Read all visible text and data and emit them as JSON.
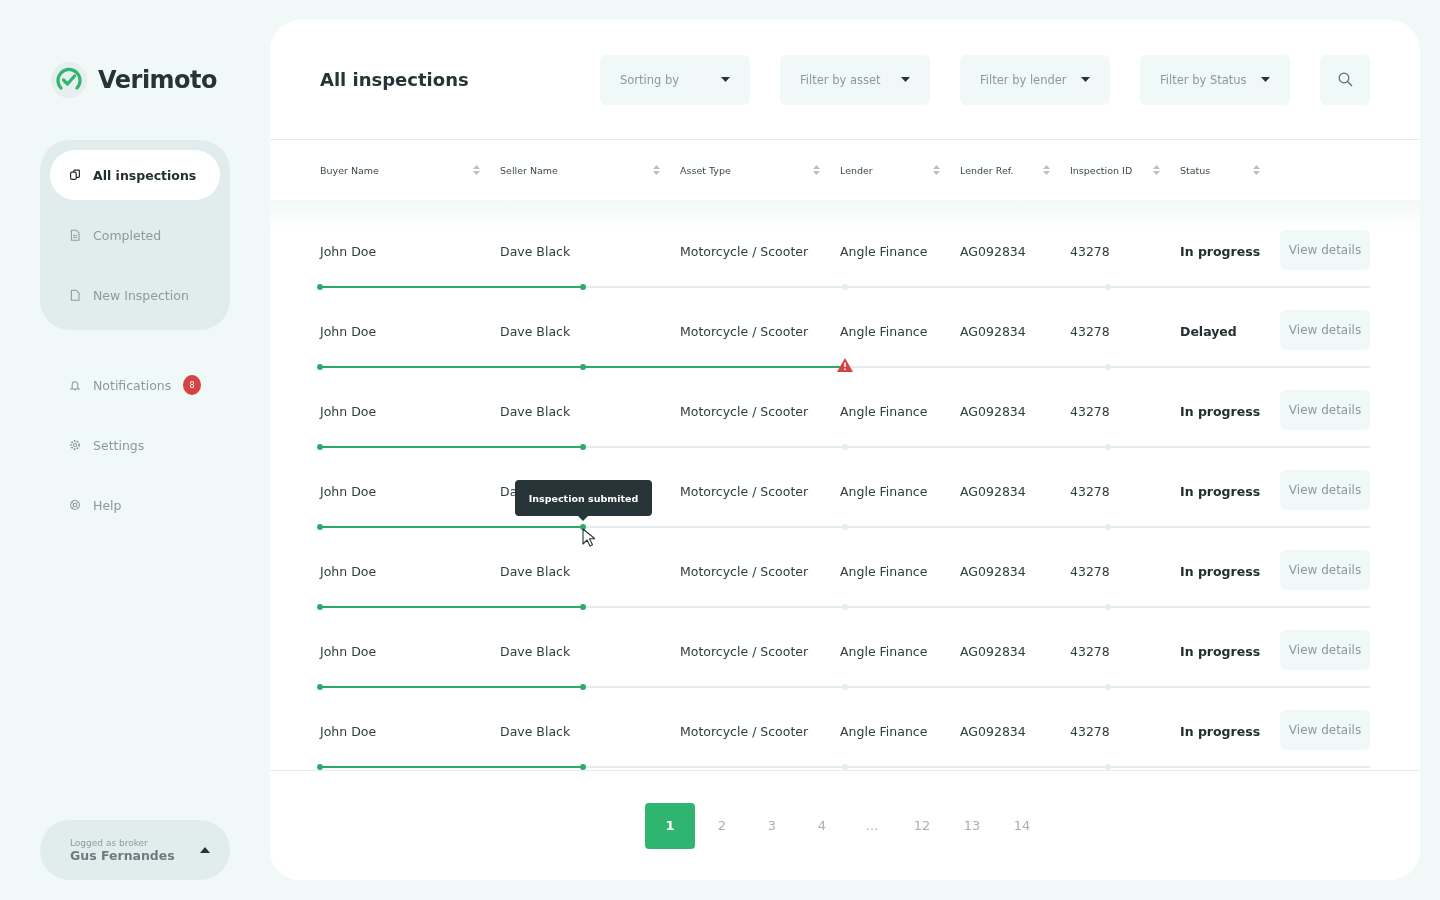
{
  "brand": {
    "name": "Verimoto"
  },
  "nav": [
    {
      "label": "All inspections",
      "selected": true
    },
    {
      "label": "Completed",
      "selected": false
    },
    {
      "label": "New Inspection",
      "selected": false
    }
  ],
  "nav_secondary": [
    {
      "label": "Notifications",
      "badge": "8"
    },
    {
      "label": "Settings"
    },
    {
      "label": "Help"
    }
  ],
  "user": {
    "caption": "Logged as broker",
    "name": "Gus Fernandes"
  },
  "page_title": "All inspections",
  "filters": [
    {
      "placeholder": "Sorting by"
    },
    {
      "placeholder": "Filter by asset"
    },
    {
      "placeholder": "Filter by lender"
    },
    {
      "placeholder": "Filter by Status"
    }
  ],
  "columns": [
    "Buyer Name",
    "Seller Name",
    "Asset Type",
    "Lender",
    "Lender Ref.",
    "Inspection ID",
    "Status"
  ],
  "rows": [
    {
      "buyer": "John Doe",
      "seller": "Dave Black",
      "asset": "Motorcycle / Scooter",
      "lender": "Angle Finance",
      "ref": "AG092834",
      "id": "43278",
      "status": "In progress",
      "action": "View details",
      "level": 0.25,
      "alert": false
    },
    {
      "buyer": "John Doe",
      "seller": "Dave Black",
      "asset": "Motorcycle / Scooter",
      "lender": "Angle Finance",
      "ref": "AG092834",
      "id": "43278",
      "status": "Delayed",
      "action": "View details",
      "level": 0.5,
      "alert": true
    },
    {
      "buyer": "John Doe",
      "seller": "Dave Black",
      "asset": "Motorcycle / Scooter",
      "lender": "Angle Finance",
      "ref": "AG092834",
      "id": "43278",
      "status": "In progress",
      "action": "View details",
      "level": 0.25,
      "alert": false
    },
    {
      "buyer": "John Doe",
      "seller": "Da",
      "asset": "Motorcycle / Scooter",
      "lender": "Angle Finance",
      "ref": "AG092834",
      "id": "43278",
      "status": "In progress",
      "action": "View details",
      "level": 0.25,
      "alert": false,
      "tooltip": "Inspection submited"
    },
    {
      "buyer": "John Doe",
      "seller": "Dave Black",
      "asset": "Motorcycle / Scooter",
      "lender": "Angle Finance",
      "ref": "AG092834",
      "id": "43278",
      "status": "In progress",
      "action": "View details",
      "level": 0.25,
      "alert": false
    },
    {
      "buyer": "John Doe",
      "seller": "Dave Black",
      "asset": "Motorcycle / Scooter",
      "lender": "Angle Finance",
      "ref": "AG092834",
      "id": "43278",
      "status": "In progress",
      "action": "View details",
      "level": 0.25,
      "alert": false
    },
    {
      "buyer": "John Doe",
      "seller": "Dave Black",
      "asset": "Motorcycle / Scooter",
      "lender": "Angle Finance",
      "ref": "AG092834",
      "id": "43278",
      "status": "In progress",
      "action": "View details",
      "level": 0.25,
      "alert": false
    }
  ],
  "pagination": [
    {
      "label": "1",
      "selected": true
    },
    {
      "label": "2",
      "selected": false
    },
    {
      "label": "3",
      "selected": false
    },
    {
      "label": "4",
      "selected": false
    },
    {
      "label": "...",
      "selected": false
    },
    {
      "label": "12",
      "selected": false
    },
    {
      "label": "13",
      "selected": false
    },
    {
      "label": "14",
      "selected": false
    }
  ]
}
